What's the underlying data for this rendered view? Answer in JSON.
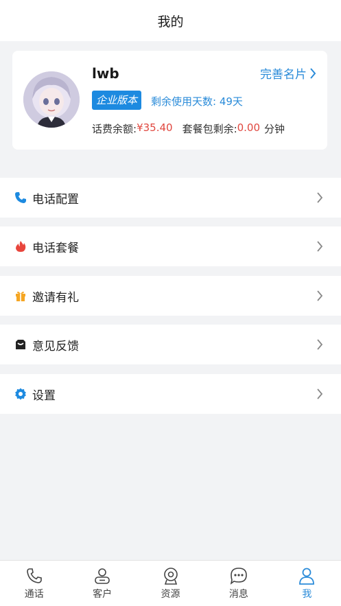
{
  "header": {
    "title": "我的"
  },
  "profile": {
    "username": "lwb",
    "complete_link": "完善名片",
    "badge": "企业版本",
    "days_remaining": "剩余使用天数: 49天",
    "balance_label": "话费余额:",
    "balance_value": "¥35.40",
    "package_label": "套餐包剩余:",
    "package_value": "0.00",
    "package_unit": "分钟"
  },
  "menu": [
    {
      "label": "电话配置",
      "icon": "phone-icon",
      "color": "#1d8ae0"
    },
    {
      "label": "电话套餐",
      "icon": "flame-icon",
      "color": "#e8453c"
    },
    {
      "label": "邀请有礼",
      "icon": "gift-icon",
      "color": "#f5a623"
    },
    {
      "label": "意见反馈",
      "icon": "feedback-icon",
      "color": "#222222"
    },
    {
      "label": "设置",
      "icon": "gear-icon",
      "color": "#1d8ae0"
    }
  ],
  "tabs": [
    {
      "label": "通话",
      "icon": "call-tab-icon"
    },
    {
      "label": "客户",
      "icon": "customer-tab-icon"
    },
    {
      "label": "资源",
      "icon": "resource-tab-icon"
    },
    {
      "label": "消息",
      "icon": "message-tab-icon"
    },
    {
      "label": "我",
      "icon": "me-tab-icon",
      "active": true
    }
  ],
  "colors": {
    "accent": "#2a8bd9",
    "alert": "#e0473f",
    "background": "#f2f3f5"
  }
}
